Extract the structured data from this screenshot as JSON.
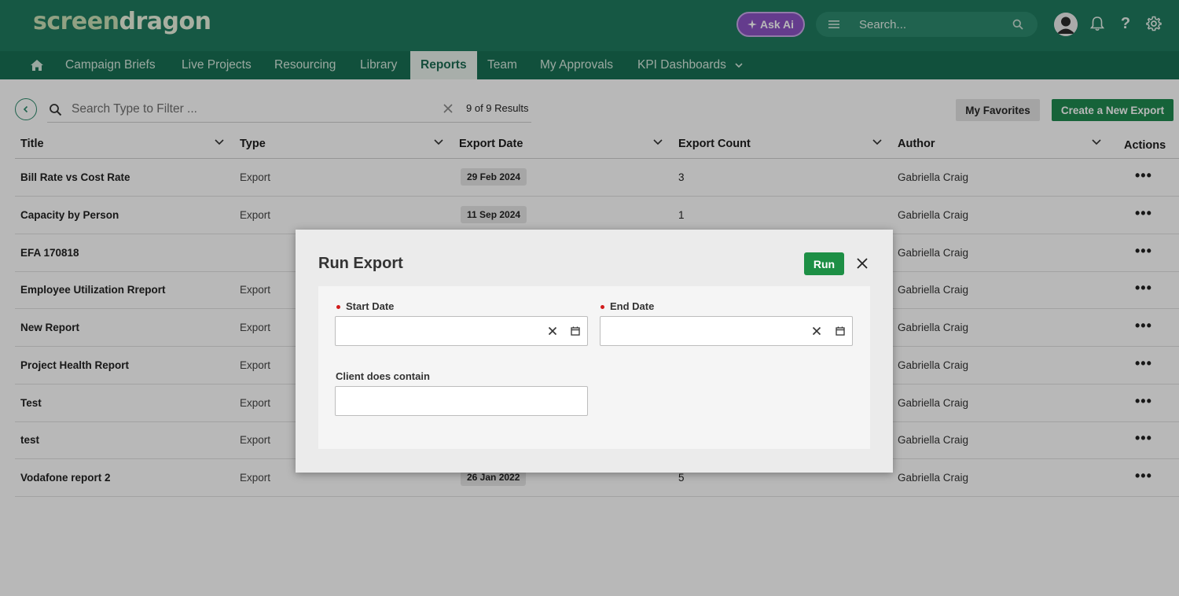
{
  "header": {
    "logo_part1": "screen",
    "logo_part2": "dragon",
    "ask_ai_label": "Ask Ai",
    "search_placeholder": "Search..."
  },
  "nav": {
    "items": [
      "Campaign Briefs",
      "Live Projects",
      "Resourcing",
      "Library",
      "Reports",
      "Team",
      "My Approvals",
      "KPI Dashboards"
    ],
    "active": "Reports"
  },
  "toolbar": {
    "filter_placeholder": "Search  Type to Filter ...",
    "results_count": "9 of 9 Results",
    "favorites_label": "My Favorites",
    "create_label": "Create a New Export"
  },
  "table": {
    "columns": [
      "Title",
      "Type",
      "Export Date",
      "Export Count",
      "Author",
      "Actions"
    ],
    "rows": [
      {
        "title": "Bill Rate vs Cost Rate",
        "type": "Export",
        "date": "29 Feb 2024",
        "count": "3",
        "author": "Gabriella Craig"
      },
      {
        "title": "Capacity by Person",
        "type": "Export",
        "date": "11 Sep 2024",
        "count": "1",
        "author": "Gabriella Craig"
      },
      {
        "title": "EFA 170818",
        "type": "",
        "date": "",
        "count": "",
        "author": "Gabriella Craig"
      },
      {
        "title": "Employee Utilization Rreport",
        "type": "Export",
        "date": "",
        "count": "",
        "author": "Gabriella Craig"
      },
      {
        "title": "New Report",
        "type": "Export",
        "date": "",
        "count": "",
        "author": "Gabriella Craig"
      },
      {
        "title": "Project Health Report",
        "type": "Export",
        "date": "",
        "count": "",
        "author": "Gabriella Craig"
      },
      {
        "title": "Test",
        "type": "Export",
        "date": "",
        "count": "",
        "author": "Gabriella Craig"
      },
      {
        "title": "test",
        "type": "Export",
        "date": "",
        "count": "",
        "author": "Gabriella Craig"
      },
      {
        "title": "Vodafone report 2",
        "type": "Export",
        "date": "26 Jan 2022",
        "count": "5",
        "author": "Gabriella Craig"
      }
    ],
    "actions_glyph": "•••"
  },
  "modal": {
    "title": "Run Export",
    "run_label": "Run",
    "start_date_label": "Start Date",
    "start_date_value": "",
    "end_date_label": "End Date",
    "end_date_value": "",
    "client_label": "Client does contain",
    "client_value": ""
  },
  "colors": {
    "header_bg": "#1f7a5f",
    "nav_bg": "#186f54",
    "primary_green": "#1f8a4f",
    "ask_ai_purple": "#8b54c4",
    "required_red": "#d11b1b"
  }
}
